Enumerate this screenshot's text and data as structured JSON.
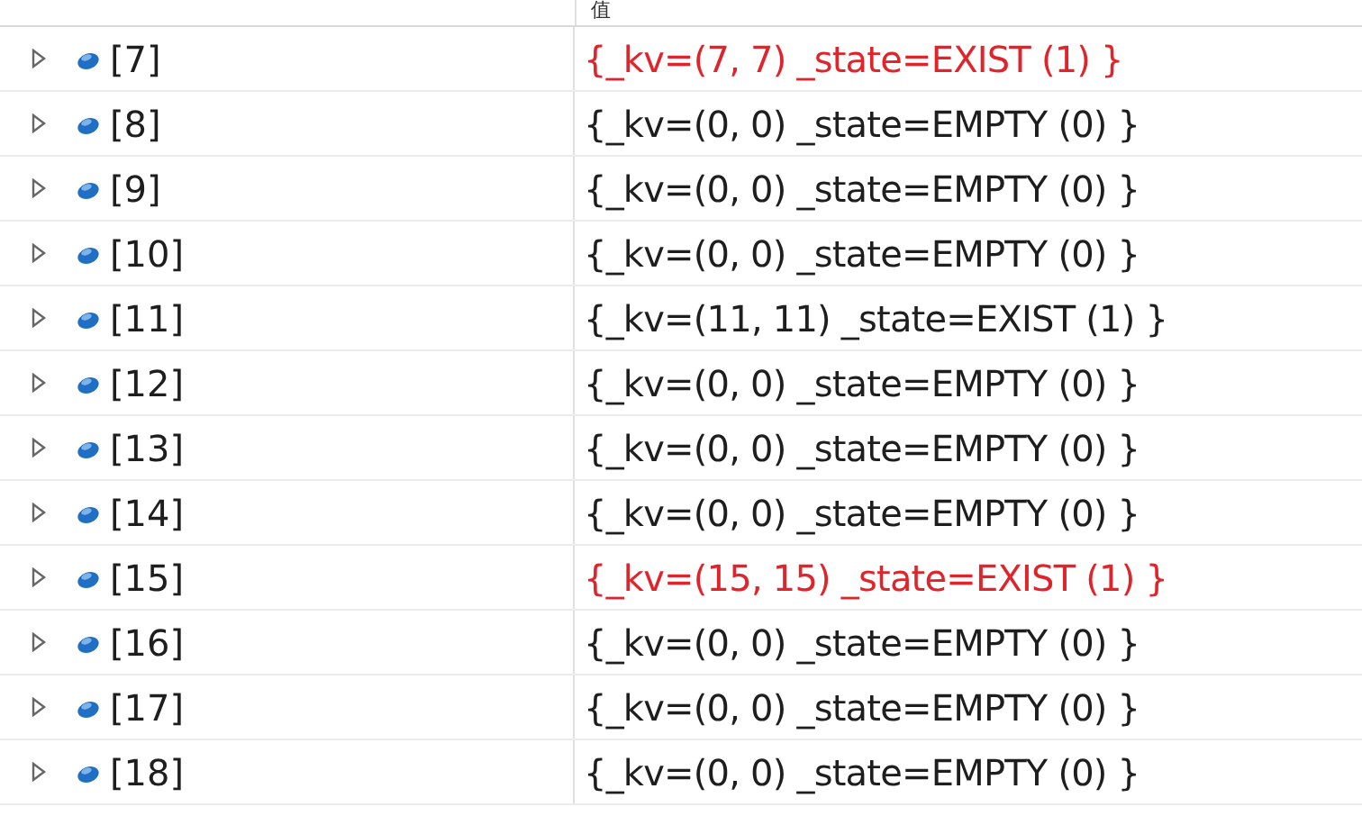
{
  "header": {
    "value_column": "值"
  },
  "rows": [
    {
      "name": "[7]",
      "value": "{_kv=(7, 7) _state=EXIST (1) }",
      "changed": true,
      "expanded": false
    },
    {
      "name": "[8]",
      "value": "{_kv=(0, 0) _state=EMPTY (0) }",
      "changed": false,
      "expanded": false
    },
    {
      "name": "[9]",
      "value": "{_kv=(0, 0) _state=EMPTY (0) }",
      "changed": false,
      "expanded": false
    },
    {
      "name": "[10]",
      "value": "{_kv=(0, 0) _state=EMPTY (0) }",
      "changed": false,
      "expanded": false
    },
    {
      "name": "[11]",
      "value": "{_kv=(11, 11) _state=EXIST (1) }",
      "changed": false,
      "expanded": false
    },
    {
      "name": "[12]",
      "value": "{_kv=(0, 0) _state=EMPTY (0) }",
      "changed": false,
      "expanded": false
    },
    {
      "name": "[13]",
      "value": "{_kv=(0, 0) _state=EMPTY (0) }",
      "changed": false,
      "expanded": false
    },
    {
      "name": "[14]",
      "value": "{_kv=(0, 0) _state=EMPTY (0) }",
      "changed": false,
      "expanded": false
    },
    {
      "name": "[15]",
      "value": "{_kv=(15, 15) _state=EXIST (1) }",
      "changed": true,
      "expanded": false
    },
    {
      "name": "[16]",
      "value": "{_kv=(0, 0) _state=EMPTY (0) }",
      "changed": false,
      "expanded": false
    },
    {
      "name": "[17]",
      "value": "{_kv=(0, 0) _state=EMPTY (0) }",
      "changed": false,
      "expanded": false
    },
    {
      "name": "[18]",
      "value": "{_kv=(0, 0) _state=EMPTY (0) }",
      "changed": false,
      "expanded": false
    }
  ]
}
